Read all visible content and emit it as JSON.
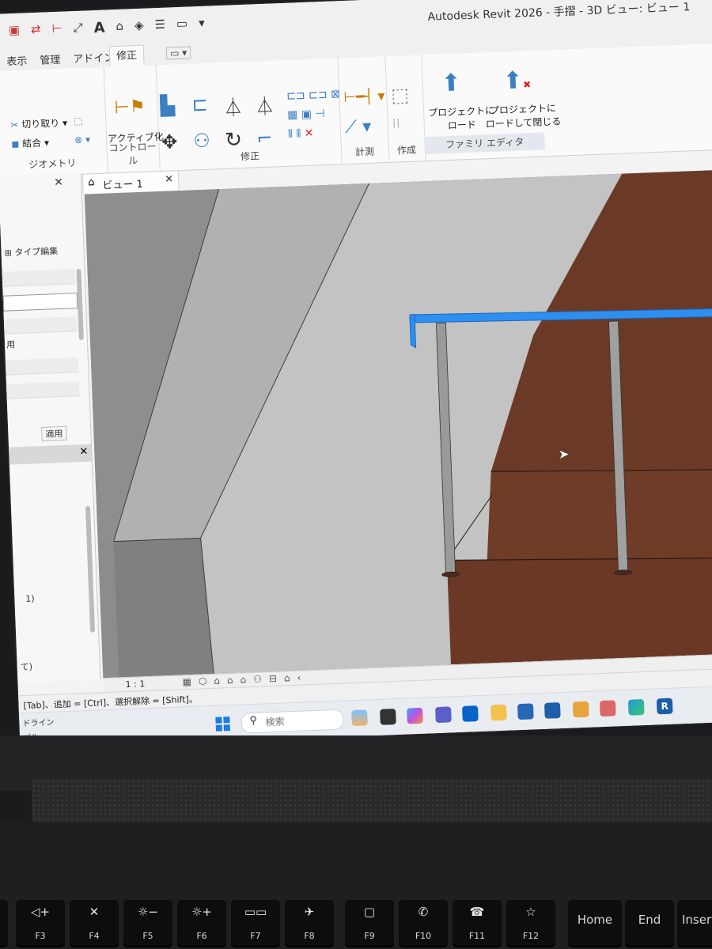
{
  "window": {
    "title": "Autodesk Revit 2026 - 手摺 - 3D ビュー: ビュー 1",
    "qat_label": "A"
  },
  "tabs": [
    {
      "label": "表示",
      "active": false
    },
    {
      "label": "管理",
      "active": false
    },
    {
      "label": "アドイン",
      "active": false
    },
    {
      "label": "修正",
      "active": true
    }
  ],
  "ribbon": {
    "cut_label": "切り取り",
    "join_label": "結合",
    "geometry_panel": "ジオメトリ",
    "activate_label": "アクティブ化",
    "control_panel": "コントロール",
    "modify_panel": "修正",
    "measure_panel": "計測",
    "create_panel": "作成",
    "load_project_label_1": "プロジェクトに",
    "load_project_label_2": "ロード",
    "load_close_label_1": "プロジェクトに",
    "load_close_label_2": "ロードして閉じる",
    "family_editor_panel": "ファミリ エディタ"
  },
  "project_browser": {
    "type_edit_label": "タイプ編集",
    "usage_text": "用",
    "apply_button": "適用",
    "param_text_1": "1)",
    "param_text_2": "て)"
  },
  "view": {
    "tab_label": "ビュー 1",
    "scale": "1 : 1"
  },
  "status_bar": {
    "text": "[Tab]、追加 = [Ctrl]、選択解除 = [Shift]。"
  },
  "taskbar": {
    "left_line1": "ドライン",
    "left_line2": "バル...",
    "search_placeholder": "検索"
  },
  "keys": [
    {
      "glyph": "◁+",
      "label": "F3"
    },
    {
      "glyph": "✕",
      "label": "F4"
    },
    {
      "glyph": "☼−",
      "label": "F5"
    },
    {
      "glyph": "☼+",
      "label": "F6"
    },
    {
      "glyph": "▭▭",
      "label": "F7"
    },
    {
      "glyph": "✈",
      "label": "F8"
    },
    {
      "glyph": "▢",
      "label": "F9"
    },
    {
      "glyph": "✆",
      "label": "F10"
    },
    {
      "glyph": "☎",
      "label": "F11"
    },
    {
      "glyph": "☆",
      "label": "F12"
    },
    {
      "glyph": "",
      "label": "Home"
    },
    {
      "glyph": "",
      "label": "End"
    },
    {
      "glyph": "",
      "label": "Insert"
    }
  ],
  "colors": {
    "selection_blue": "#2f8ff0",
    "wood_brown": "#6b3a27",
    "wall_gray": "#9e9e9e"
  }
}
